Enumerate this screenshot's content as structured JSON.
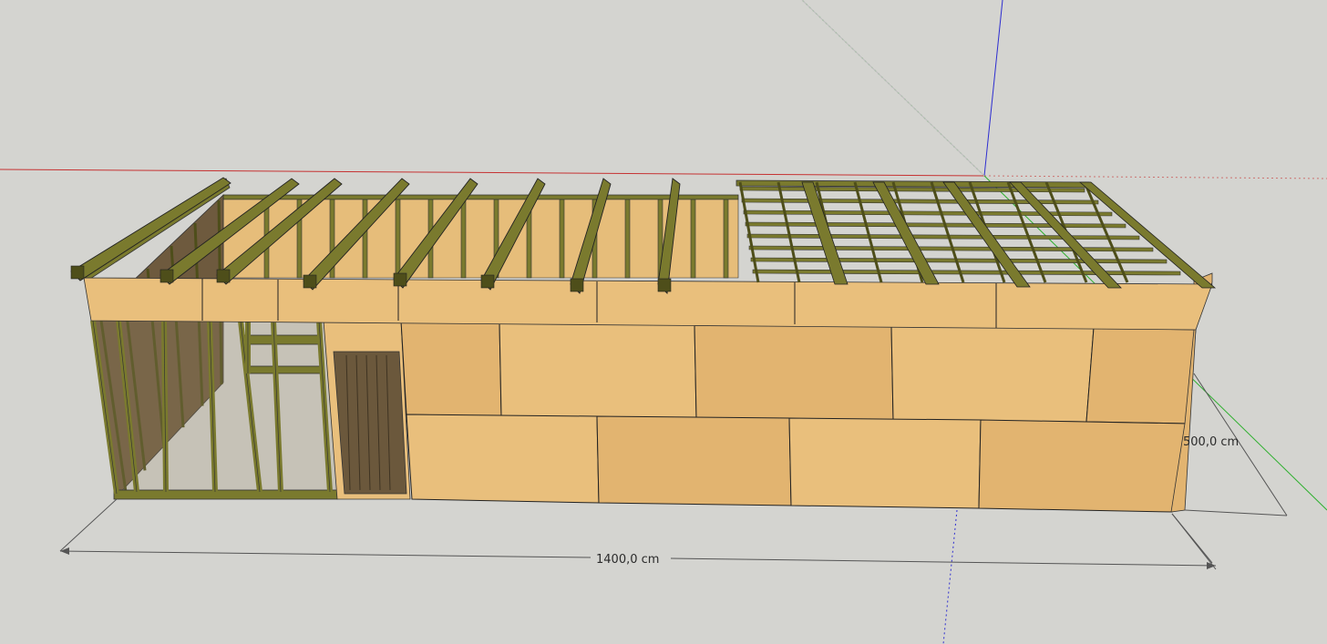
{
  "app": {
    "name": "3D modeling viewport"
  },
  "colors": {
    "background": "#d4d4d0",
    "osb_board": "#e9bf7c",
    "osb_board_shade": "#e2b470",
    "timber": "#7a7a2e",
    "timber_dark": "#4e4e1a",
    "axis_red": "#c63232",
    "axis_green": "#2fb02f",
    "axis_blue": "#2d2dd0",
    "dimension_line": "#555555"
  },
  "axes": {
    "red": {
      "icon": "red-axis-line"
    },
    "green": {
      "icon": "green-axis-line"
    },
    "blue": {
      "icon": "blue-axis-line"
    }
  },
  "dimensions": {
    "length": {
      "label": "1400,0 cm"
    },
    "width": {
      "label": "500,0 cm"
    }
  },
  "model": {
    "description_icon": "timber-frame-building",
    "rafters_count": 8,
    "grid_beams_count": 5
  }
}
